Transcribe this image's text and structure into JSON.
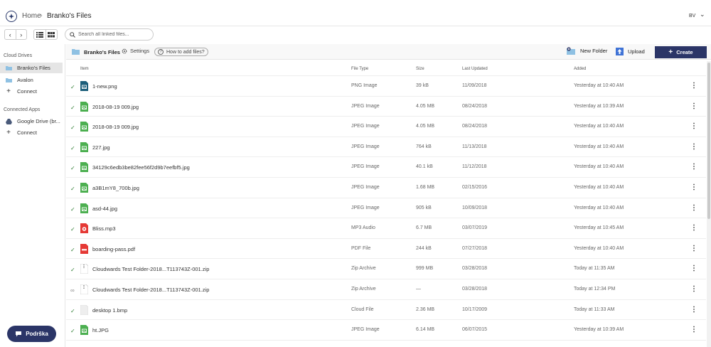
{
  "topbar": {
    "home": "Home",
    "separator": "›",
    "current": "Branko's Files",
    "user_initials": "BV"
  },
  "search": {
    "placeholder": "Search all linked files..."
  },
  "sidebar": {
    "cloud_drives_heading": "Cloud Drives",
    "cloud_drives": [
      {
        "label": "Branko's Files",
        "icon": "folder-icon",
        "active": true
      },
      {
        "label": "Avalon",
        "icon": "folder-icon",
        "active": false
      }
    ],
    "connect_label": "Connect",
    "connected_apps_heading": "Connected Apps",
    "connected_apps": [
      {
        "label": "Google Drive (br...",
        "icon": "google-drive-icon"
      }
    ],
    "connect2_label": "Connect",
    "support_label": "Podrška"
  },
  "content_header": {
    "title": "Branko's Files",
    "settings_label": "Settings",
    "help_label": "How to add files?",
    "new_folder_label": "New Folder",
    "upload_label": "Upload",
    "create_label": "Create"
  },
  "table": {
    "columns": [
      "Item",
      "File Type",
      "Size",
      "Last Updated",
      "Added"
    ],
    "rows": [
      {
        "status": "synced",
        "icon": "image-icon",
        "icon_color": "#1b5e7a",
        "name": "1-new.png",
        "type": "PNG Image",
        "size": "39 kB",
        "updated": "11/09/2018",
        "added": "Yesterday at 10:40 AM"
      },
      {
        "status": "synced",
        "icon": "image-icon",
        "icon_color": "#4caf50",
        "name": "2018-08-19 009.jpg",
        "type": "JPEG Image",
        "size": "4.05 MB",
        "updated": "08/24/2018",
        "added": "Yesterday at 10:39 AM"
      },
      {
        "status": "synced",
        "icon": "image-icon",
        "icon_color": "#4caf50",
        "name": "2018-08-19 009.jpg",
        "type": "JPEG Image",
        "size": "4.05 MB",
        "updated": "08/24/2018",
        "added": "Yesterday at 10:40 AM"
      },
      {
        "status": "synced",
        "icon": "image-icon",
        "icon_color": "#4caf50",
        "name": "227.jpg",
        "type": "JPEG Image",
        "size": "764 kB",
        "updated": "11/13/2018",
        "added": "Yesterday at 10:40 AM"
      },
      {
        "status": "synced",
        "icon": "image-icon",
        "icon_color": "#4caf50",
        "name": "34129c6edb3be82fee56f2d9b7eefbf5.jpg",
        "type": "JPEG Image",
        "size": "40.1 kB",
        "updated": "11/12/2018",
        "added": "Yesterday at 10:40 AM"
      },
      {
        "status": "synced",
        "icon": "image-icon",
        "icon_color": "#4caf50",
        "name": "a3B1mY8_700b.jpg",
        "type": "JPEG Image",
        "size": "1.68 MB",
        "updated": "02/15/2016",
        "added": "Yesterday at 10:40 AM"
      },
      {
        "status": "synced",
        "icon": "image-icon",
        "icon_color": "#4caf50",
        "name": "asd-44.jpg",
        "type": "JPEG Image",
        "size": "905 kB",
        "updated": "10/09/2018",
        "added": "Yesterday at 10:40 AM"
      },
      {
        "status": "synced",
        "icon": "audio-icon",
        "icon_color": "#e53935",
        "name": "Bliss.mp3",
        "type": "MP3 Audio",
        "size": "6.7 MB",
        "updated": "03/07/2019",
        "added": "Yesterday at 10:45 AM"
      },
      {
        "status": "synced",
        "icon": "pdf-icon",
        "icon_color": "#e53935",
        "name": "boarding-pass.pdf",
        "type": "PDF File",
        "size": "244 kB",
        "updated": "07/27/2018",
        "added": "Yesterday at 10:40 AM"
      },
      {
        "status": "synced",
        "icon": "zip-icon",
        "icon_color": "#ffffff",
        "name": "Cloudwards Test Folder-2018...T113743Z-001.zip",
        "type": "Zip Archive",
        "size": "999 MB",
        "updated": "03/28/2018",
        "added": "Today at 11:35 AM"
      },
      {
        "status": "linked",
        "icon": "zip-icon",
        "icon_color": "#ffffff",
        "name": "Cloudwards Test Folder-2018...T113743Z-001.zip",
        "type": "Zip Archive",
        "size": "—",
        "updated": "03/28/2018",
        "added": "Today at 12:34 PM"
      },
      {
        "status": "synced",
        "icon": "file-icon",
        "icon_color": "#eeeeee",
        "name": "desktop 1.bmp",
        "type": "Cloud File",
        "size": "2.36 MB",
        "updated": "10/17/2009",
        "added": "Today at 11:33 AM"
      },
      {
        "status": "synced",
        "icon": "image-icon",
        "icon_color": "#4caf50",
        "name": "ht.JPG",
        "type": "JPEG Image",
        "size": "6.14 MB",
        "updated": "06/07/2015",
        "added": "Yesterday at 10:39 AM"
      }
    ]
  },
  "colors": {
    "accent": "#2b3567",
    "synced_check": "#2e7d32",
    "folder": "#8fc1e3"
  }
}
